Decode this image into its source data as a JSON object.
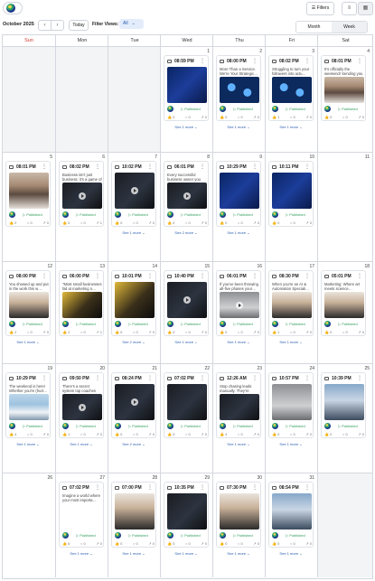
{
  "header": {
    "filters_label": "Filters"
  },
  "toolbar": {
    "month_label": "October 2025",
    "prev": "‹",
    "next": "›",
    "today_label": "Today",
    "filter_views_label": "Filter Views:",
    "filter_views_value": "All",
    "view_month": "Month",
    "view_week": "Week"
  },
  "weekdays": [
    "Sun",
    "Mon",
    "Tue",
    "Wed",
    "Thu",
    "Fri",
    "Sat"
  ],
  "status_colors": {
    "published": "#2e9c5a",
    "sunday": "#d0342c",
    "link": "#2a5db0"
  },
  "weeks": [
    [
      {
        "day": "",
        "empty": true
      },
      {
        "day": "",
        "empty": true
      },
      {
        "day": "",
        "empty": true
      },
      {
        "day": "1",
        "post": {
          "time": "08:59 PM",
          "text": "",
          "thumb": "t-blue",
          "video": false,
          "status": "Published",
          "stats": [
            "0",
            "0",
            "0"
          ]
        },
        "more": "See 1 more"
      },
      {
        "day": "2",
        "post": {
          "time": "08:00 PM",
          "text": "More Than a Service. We're Your Strategic…",
          "thumb": "t-diagram",
          "video": false,
          "status": "Published",
          "stats": [
            "0",
            "0",
            "0"
          ]
        },
        "more": "See 1 more"
      },
      {
        "day": "3",
        "post": {
          "time": "08:02 PM",
          "text": "Struggling to turn your followers into actu…",
          "thumb": "t-diagram",
          "video": false,
          "status": "Published",
          "stats": [
            "1",
            "0",
            "0"
          ]
        },
        "more": "See 1 more"
      },
      {
        "day": "4",
        "post": {
          "time": "08:01 PM",
          "text": "It's officially the weekend! Sending you all…",
          "thumb": "t-portrait",
          "video": false,
          "status": "Published",
          "stats": [
            "0",
            "0",
            "0"
          ]
        },
        "more": ""
      }
    ],
    [
      {
        "day": "5",
        "post": {
          "time": "08:01 PM",
          "text": "",
          "thumb": "t-portrait",
          "video": false,
          "status": "Published",
          "stats": [
            "2",
            "0",
            "0"
          ]
        },
        "more": ""
      },
      {
        "day": "6",
        "post": {
          "time": "08:02 PM",
          "text": "Business isn't just business; it's a game of s…",
          "thumb": "t-dark",
          "video": true,
          "status": "Published",
          "stats": [
            "0",
            "0",
            "1"
          ]
        },
        "more": ""
      },
      {
        "day": "7",
        "post": {
          "time": "10:02 PM",
          "text": "",
          "thumb": "t-dark",
          "video": true,
          "status": "Published",
          "stats": [
            "0",
            "0",
            "0"
          ]
        },
        "more": "See 1 more"
      },
      {
        "day": "8",
        "post": {
          "time": "06:01 PM",
          "text": "Every successful business owner you admir…",
          "thumb": "t-dark",
          "video": true,
          "status": "Published",
          "stats": [
            "0",
            "0",
            "0"
          ]
        },
        "more": "See 2 more"
      },
      {
        "day": "9",
        "post": {
          "time": "10:29 PM",
          "text": "",
          "thumb": "t-blue",
          "video": false,
          "status": "Published",
          "stats": [
            "0",
            "0",
            "0"
          ]
        },
        "more": "See 1 more"
      },
      {
        "day": "10",
        "post": {
          "time": "10:11 PM",
          "text": "",
          "thumb": "t-blue",
          "video": false,
          "status": "Published",
          "stats": [
            "0",
            "0",
            "0"
          ]
        },
        "more": ""
      },
      {
        "day": "11",
        "empty_day": true
      }
    ],
    [
      {
        "day": "12",
        "post": {
          "time": "08:00 PM",
          "text": "You showed up and put in the work this w…",
          "thumb": "t-people",
          "video": false,
          "status": "Published",
          "stats": [
            "2",
            "0",
            "0"
          ]
        },
        "more": "See 1 more"
      },
      {
        "day": "13",
        "post": {
          "time": "06:00 PM",
          "text": "\"Most small businesses fail at marketing n…",
          "thumb": "t-gold",
          "video": false,
          "status": "Published",
          "stats": [
            "2",
            "0",
            "1"
          ]
        },
        "more": ""
      },
      {
        "day": "14",
        "post": {
          "time": "10:01 PM",
          "text": "",
          "thumb": "t-gold",
          "video": false,
          "status": "Published",
          "stats": [
            "0",
            "0",
            "0"
          ]
        },
        "more": "See 2 more"
      },
      {
        "day": "15",
        "post": {
          "time": "10:40 PM",
          "text": "",
          "thumb": "t-dark",
          "video": true,
          "status": "Published",
          "stats": [
            "0",
            "0",
            "0"
          ]
        },
        "more": "See 1 more"
      },
      {
        "day": "16",
        "post": {
          "time": "06:01 PM",
          "text": "If you've been throwing all-five phases your…",
          "thumb": "t-grey",
          "video": true,
          "status": "Published",
          "stats": [
            "0",
            "0",
            "0"
          ]
        },
        "more": "See 1 more"
      },
      {
        "day": "17",
        "post": {
          "time": "08:30 PM",
          "text": "When you're an AI & Automation Speciali…",
          "thumb": "t-people",
          "video": false,
          "status": "Published",
          "stats": [
            "1",
            "0",
            "0"
          ]
        },
        "more": "See 1 more"
      },
      {
        "day": "18",
        "post": {
          "time": "05:01 PM",
          "text": "Marketing: Where art meets science…",
          "thumb": "t-people",
          "video": false,
          "status": "Published",
          "stats": [
            "0",
            "0",
            "0"
          ]
        },
        "more": ""
      }
    ],
    [
      {
        "day": "19",
        "post": {
          "time": "10:29 PM",
          "text": "The weekend is here! Whether you're (hurt…",
          "thumb": "t-ocean",
          "video": false,
          "status": "Published",
          "stats": [
            "4",
            "0",
            "0"
          ]
        },
        "more": "See 1 more"
      },
      {
        "day": "20",
        "post": {
          "time": "09:50 PM",
          "text": "There's a secret system top coaches use f…",
          "thumb": "t-dark",
          "video": true,
          "status": "Published",
          "stats": [
            "1",
            "0",
            "0"
          ]
        },
        "more": "See 1 more"
      },
      {
        "day": "21",
        "post": {
          "time": "08:24 PM",
          "text": "",
          "thumb": "t-dark",
          "video": true,
          "status": "Published",
          "stats": [
            "0",
            "0",
            "0"
          ]
        },
        "more": "See 2 more"
      },
      {
        "day": "22",
        "post": {
          "time": "07:02 PM",
          "text": "",
          "thumb": "t-dark",
          "video": false,
          "status": "Published",
          "stats": [
            "0",
            "0",
            "0"
          ]
        },
        "more": ""
      },
      {
        "day": "23",
        "post": {
          "time": "12:26 AM",
          "text": "Stop chasing leads manually. They're alrea…",
          "thumb": "t-dark",
          "video": false,
          "status": "Published",
          "stats": [
            "4",
            "0",
            "0"
          ]
        },
        "more": "See 1 more"
      },
      {
        "day": "24",
        "post": {
          "time": "10:57 PM",
          "text": "",
          "thumb": "t-grey",
          "video": false,
          "status": "Published",
          "stats": [
            "0",
            "0",
            "0"
          ]
        },
        "more": "See 1 more"
      },
      {
        "day": "25",
        "post": {
          "time": "10:39 PM",
          "text": "",
          "thumb": "t-scene",
          "video": false,
          "status": "Published",
          "stats": [
            "0",
            "0",
            "0"
          ]
        },
        "more": ""
      }
    ],
    [
      {
        "day": "26",
        "empty_day": true
      },
      {
        "day": "27",
        "post": {
          "time": "07:02 PM",
          "text": "Imagine a world where your most importa…",
          "thumb": "",
          "video": false,
          "status": "Published",
          "stats": [
            "6",
            "0",
            "0"
          ]
        },
        "more": "See 1 more"
      },
      {
        "day": "28",
        "post": {
          "time": "07:00 PM",
          "text": "",
          "thumb": "t-people",
          "video": false,
          "status": "Published",
          "stats": [
            "0",
            "0",
            "0"
          ]
        },
        "more": "See 1 more"
      },
      {
        "day": "29",
        "post": {
          "time": "10:35 PM",
          "text": "",
          "thumb": "t-dark",
          "video": false,
          "status": "Published",
          "stats": [
            "0",
            "0",
            "0"
          ]
        },
        "more": "See 1 more"
      },
      {
        "day": "30",
        "post": {
          "time": "07:30 PM",
          "text": "",
          "thumb": "t-people",
          "video": false,
          "status": "Published",
          "stats": [
            "0",
            "0",
            "0"
          ]
        },
        "more": "See 1 more"
      },
      {
        "day": "31",
        "post": {
          "time": "08:54 PM",
          "text": "",
          "thumb": "t-scene",
          "video": false,
          "status": "Published",
          "stats": [
            "0",
            "0",
            "0"
          ]
        },
        "more": "See 1 more"
      },
      {
        "day": "",
        "empty": true
      }
    ]
  ]
}
